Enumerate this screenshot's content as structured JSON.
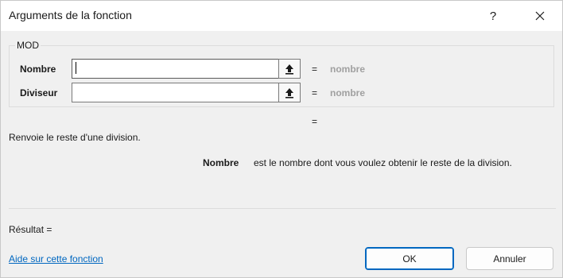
{
  "window": {
    "title": "Arguments de la fonction",
    "help_glyph": "?",
    "close_icon": "close-icon"
  },
  "function": {
    "name": "MOD",
    "arguments": [
      {
        "label": "Nombre",
        "value": "",
        "equals": "=",
        "hint": "nombre"
      },
      {
        "label": "Diviseur",
        "value": "",
        "equals": "=",
        "hint": "nombre"
      }
    ],
    "result_equals": "=",
    "description": "Renvoie le reste d'une division.",
    "arg_help": {
      "name": "Nombre",
      "text": "est le nombre dont vous voulez obtenir le reste de la division."
    }
  },
  "footer": {
    "result_label": "Résultat =",
    "help_link": "Aide sur cette fonction",
    "ok_label": "OK",
    "cancel_label": "Annuler"
  },
  "icons": {
    "ref_button": "collapse-dialog-icon"
  },
  "colors": {
    "link": "#0067c0",
    "hint": "#a0a0a0",
    "dialog_bg": "#f0f0f0",
    "focus": "#0067c0"
  }
}
